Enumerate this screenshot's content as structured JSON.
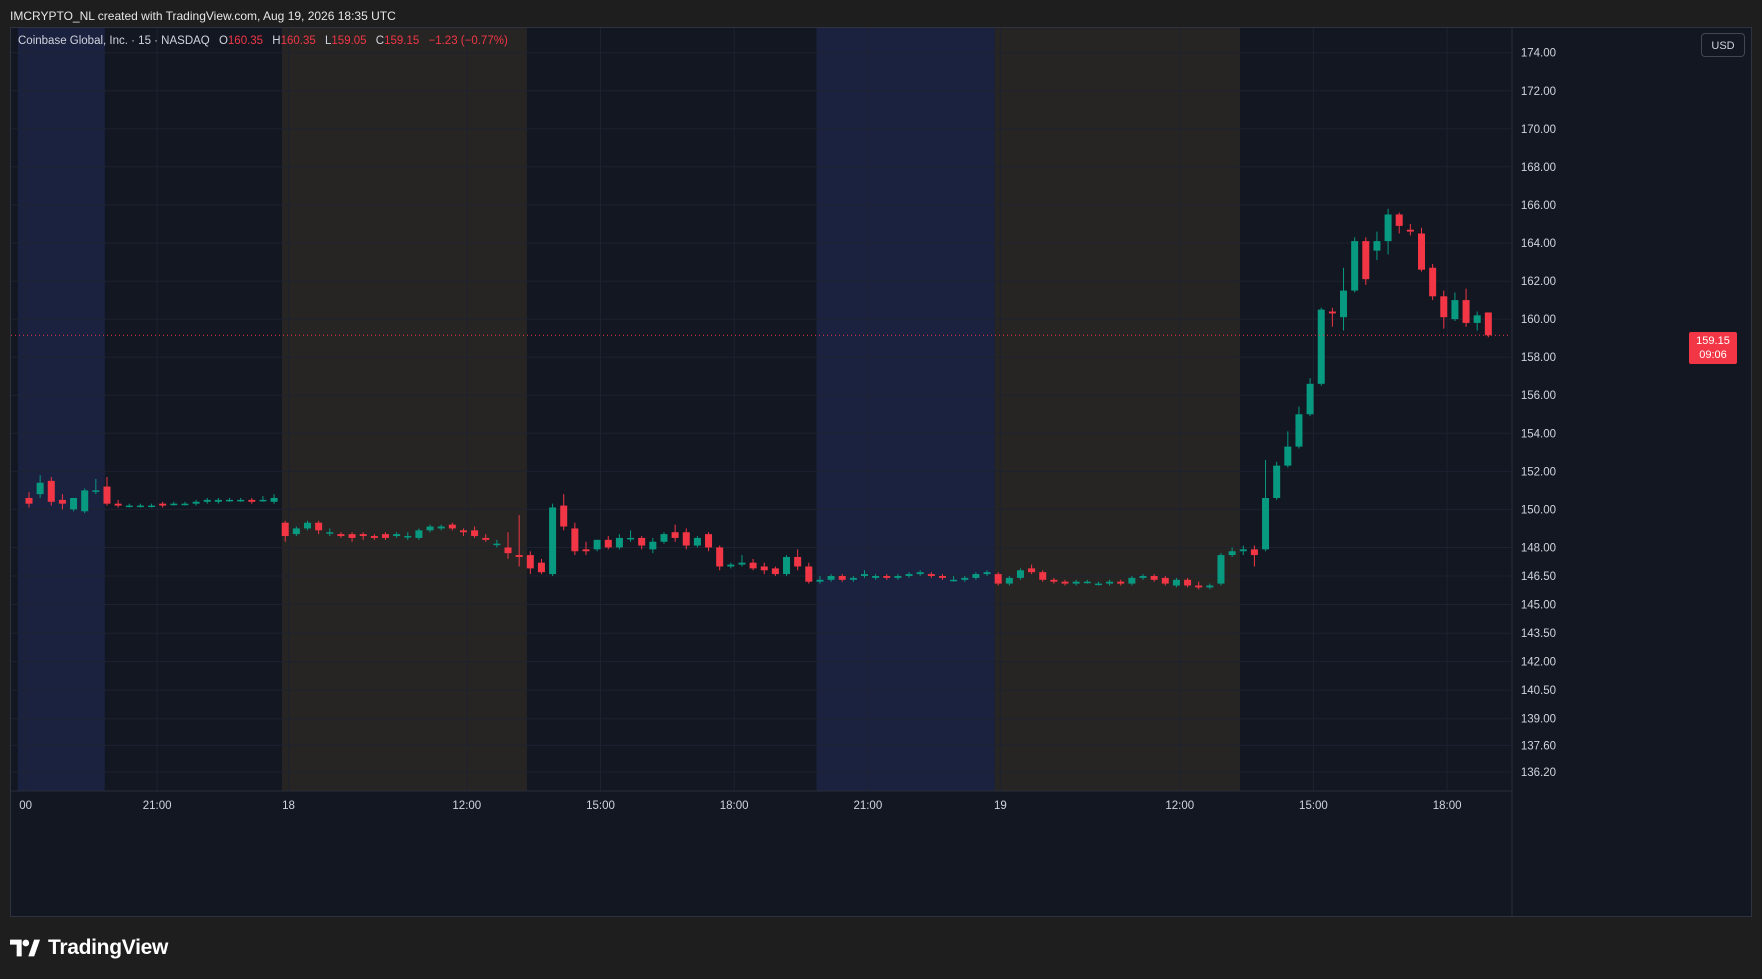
{
  "caption": "IMCRYPTO_NL created with TradingView.com, Aug 19, 2026 18:35 UTC",
  "legend": {
    "symbol": "Coinbase Global, Inc. · 15 · NASDAQ",
    "open_key": "O",
    "open_val": "160.35",
    "high_key": "H",
    "high_val": "160.35",
    "low_key": "L",
    "low_val": "159.05",
    "close_key": "C",
    "close_val": "159.15",
    "change": "−1.23 (−0.77%)"
  },
  "currency": "USD",
  "last_price": {
    "price": "159.15",
    "countdown": "09:06"
  },
  "brand": {
    "name": "TradingView"
  },
  "colors": {
    "up": "#089981",
    "down": "#f23645",
    "background": "#131722",
    "grid": "#1e2230",
    "session_blue": "#1a2240",
    "session_tan": "#262524"
  },
  "chart_data": {
    "type": "candlestick",
    "interval": "15",
    "ylim": [
      135.2,
      175.3
    ],
    "y_ticks": [
      174.0,
      172.0,
      170.0,
      168.0,
      166.0,
      164.0,
      162.0,
      160.0,
      158.0,
      156.0,
      154.0,
      152.0,
      150.0,
      148.0,
      146.5,
      145.0,
      143.5,
      142.0,
      140.5,
      139.0,
      137.6,
      136.2
    ],
    "x_ticks": [
      {
        "label": "00",
        "index": -0.3
      },
      {
        "label": "21:00",
        "index": 11.5
      },
      {
        "label": "18",
        "index": 23.3
      },
      {
        "label": "12:00",
        "index": 39.3
      },
      {
        "label": "15:00",
        "index": 51.3
      },
      {
        "label": "18:00",
        "index": 63.3
      },
      {
        "label": "21:00",
        "index": 75.3
      },
      {
        "label": "19",
        "index": 87.2
      },
      {
        "label": "12:00",
        "index": 103.3
      },
      {
        "label": "15:00",
        "index": 115.3
      },
      {
        "label": "18:00",
        "index": 127.3
      }
    ],
    "sessions": [
      {
        "start": -1.0,
        "end": 6.8,
        "type": "blue"
      },
      {
        "start": 22.7,
        "end": 44.7,
        "type": "tan"
      },
      {
        "start": 70.7,
        "end": 86.7,
        "type": "blue"
      },
      {
        "start": 86.7,
        "end": 108.7,
        "type": "tan"
      }
    ],
    "candles": [
      {
        "o": 150.6,
        "h": 150.9,
        "l": 150.1,
        "c": 150.3
      },
      {
        "o": 150.8,
        "h": 151.8,
        "l": 150.6,
        "c": 151.4
      },
      {
        "o": 151.5,
        "h": 151.7,
        "l": 150.2,
        "c": 150.4
      },
      {
        "o": 150.5,
        "h": 150.8,
        "l": 150.0,
        "c": 150.3
      },
      {
        "o": 150.0,
        "h": 150.6,
        "l": 149.9,
        "c": 150.6
      },
      {
        "o": 149.9,
        "h": 151.1,
        "l": 149.8,
        "c": 151.0
      },
      {
        "o": 151.0,
        "h": 151.6,
        "l": 150.8,
        "c": 151.0
      },
      {
        "o": 151.2,
        "h": 151.7,
        "l": 150.2,
        "c": 150.3
      },
      {
        "o": 150.3,
        "h": 150.5,
        "l": 150.1,
        "c": 150.2
      },
      {
        "o": 150.2,
        "h": 150.3,
        "l": 150.1,
        "c": 150.2
      },
      {
        "o": 150.2,
        "h": 150.3,
        "l": 150.1,
        "c": 150.2
      },
      {
        "o": 150.2,
        "h": 150.3,
        "l": 150.1,
        "c": 150.2
      },
      {
        "o": 150.3,
        "h": 150.4,
        "l": 150.1,
        "c": 150.2
      },
      {
        "o": 150.3,
        "h": 150.4,
        "l": 150.2,
        "c": 150.3
      },
      {
        "o": 150.3,
        "h": 150.4,
        "l": 150.2,
        "c": 150.3
      },
      {
        "o": 150.3,
        "h": 150.5,
        "l": 150.2,
        "c": 150.4
      },
      {
        "o": 150.4,
        "h": 150.6,
        "l": 150.3,
        "c": 150.5
      },
      {
        "o": 150.4,
        "h": 150.6,
        "l": 150.3,
        "c": 150.5
      },
      {
        "o": 150.5,
        "h": 150.6,
        "l": 150.4,
        "c": 150.5
      },
      {
        "o": 150.5,
        "h": 150.6,
        "l": 150.4,
        "c": 150.5
      },
      {
        "o": 150.5,
        "h": 150.6,
        "l": 150.3,
        "c": 150.4
      },
      {
        "o": 150.5,
        "h": 150.7,
        "l": 150.4,
        "c": 150.5
      },
      {
        "o": 150.4,
        "h": 150.8,
        "l": 150.3,
        "c": 150.6
      },
      {
        "o": 149.3,
        "h": 149.4,
        "l": 148.3,
        "c": 148.6
      },
      {
        "o": 148.7,
        "h": 149.1,
        "l": 148.6,
        "c": 149.0
      },
      {
        "o": 149.0,
        "h": 149.4,
        "l": 148.9,
        "c": 149.3
      },
      {
        "o": 149.3,
        "h": 149.4,
        "l": 148.7,
        "c": 148.9
      },
      {
        "o": 148.8,
        "h": 149.0,
        "l": 148.6,
        "c": 148.8
      },
      {
        "o": 148.7,
        "h": 148.8,
        "l": 148.5,
        "c": 148.6
      },
      {
        "o": 148.7,
        "h": 148.8,
        "l": 148.3,
        "c": 148.5
      },
      {
        "o": 148.7,
        "h": 148.8,
        "l": 148.4,
        "c": 148.6
      },
      {
        "o": 148.6,
        "h": 148.7,
        "l": 148.4,
        "c": 148.5
      },
      {
        "o": 148.7,
        "h": 148.8,
        "l": 148.4,
        "c": 148.5
      },
      {
        "o": 148.6,
        "h": 148.8,
        "l": 148.5,
        "c": 148.7
      },
      {
        "o": 148.6,
        "h": 148.8,
        "l": 148.4,
        "c": 148.6
      },
      {
        "o": 148.5,
        "h": 149.0,
        "l": 148.4,
        "c": 148.9
      },
      {
        "o": 148.9,
        "h": 149.2,
        "l": 148.8,
        "c": 149.1
      },
      {
        "o": 149.0,
        "h": 149.2,
        "l": 148.9,
        "c": 149.1
      },
      {
        "o": 149.2,
        "h": 149.3,
        "l": 148.9,
        "c": 149.0
      },
      {
        "o": 148.9,
        "h": 149.0,
        "l": 148.6,
        "c": 148.8
      },
      {
        "o": 148.9,
        "h": 149.1,
        "l": 148.5,
        "c": 148.6
      },
      {
        "o": 148.5,
        "h": 148.7,
        "l": 148.3,
        "c": 148.4
      },
      {
        "o": 148.2,
        "h": 148.4,
        "l": 148.0,
        "c": 148.2
      },
      {
        "o": 148.0,
        "h": 148.8,
        "l": 147.4,
        "c": 147.7
      },
      {
        "o": 147.6,
        "h": 149.7,
        "l": 147.0,
        "c": 147.5
      },
      {
        "o": 147.6,
        "h": 147.8,
        "l": 146.6,
        "c": 146.9
      },
      {
        "o": 147.2,
        "h": 147.4,
        "l": 146.6,
        "c": 146.7
      },
      {
        "o": 146.6,
        "h": 150.3,
        "l": 146.5,
        "c": 150.1
      },
      {
        "o": 150.2,
        "h": 150.8,
        "l": 148.9,
        "c": 149.1
      },
      {
        "o": 149.0,
        "h": 149.3,
        "l": 147.6,
        "c": 147.8
      },
      {
        "o": 147.9,
        "h": 148.3,
        "l": 147.6,
        "c": 147.8
      },
      {
        "o": 147.9,
        "h": 148.4,
        "l": 147.8,
        "c": 148.4
      },
      {
        "o": 148.4,
        "h": 148.6,
        "l": 147.9,
        "c": 148.0
      },
      {
        "o": 148.0,
        "h": 148.7,
        "l": 147.9,
        "c": 148.5
      },
      {
        "o": 148.5,
        "h": 148.9,
        "l": 148.3,
        "c": 148.5
      },
      {
        "o": 148.5,
        "h": 148.6,
        "l": 147.9,
        "c": 148.1
      },
      {
        "o": 147.9,
        "h": 148.5,
        "l": 147.7,
        "c": 148.3
      },
      {
        "o": 148.3,
        "h": 148.8,
        "l": 148.2,
        "c": 148.7
      },
      {
        "o": 148.8,
        "h": 149.2,
        "l": 148.3,
        "c": 148.5
      },
      {
        "o": 148.8,
        "h": 149.0,
        "l": 147.9,
        "c": 148.1
      },
      {
        "o": 148.1,
        "h": 148.6,
        "l": 148.0,
        "c": 148.5
      },
      {
        "o": 148.7,
        "h": 148.8,
        "l": 147.8,
        "c": 148.0
      },
      {
        "o": 148.0,
        "h": 148.1,
        "l": 146.8,
        "c": 147.0
      },
      {
        "o": 147.0,
        "h": 147.2,
        "l": 146.9,
        "c": 147.1
      },
      {
        "o": 147.1,
        "h": 147.6,
        "l": 147.0,
        "c": 147.2
      },
      {
        "o": 147.2,
        "h": 147.4,
        "l": 146.8,
        "c": 146.9
      },
      {
        "o": 147.0,
        "h": 147.2,
        "l": 146.6,
        "c": 146.8
      },
      {
        "o": 146.9,
        "h": 147.0,
        "l": 146.5,
        "c": 146.6
      },
      {
        "o": 146.6,
        "h": 147.6,
        "l": 146.5,
        "c": 147.5
      },
      {
        "o": 147.5,
        "h": 147.9,
        "l": 146.8,
        "c": 147.0
      },
      {
        "o": 147.0,
        "h": 147.2,
        "l": 146.1,
        "c": 146.2
      },
      {
        "o": 146.2,
        "h": 146.5,
        "l": 146.1,
        "c": 146.3
      },
      {
        "o": 146.3,
        "h": 146.6,
        "l": 146.2,
        "c": 146.5
      },
      {
        "o": 146.5,
        "h": 146.6,
        "l": 146.2,
        "c": 146.3
      },
      {
        "o": 146.3,
        "h": 146.5,
        "l": 146.2,
        "c": 146.4
      },
      {
        "o": 146.5,
        "h": 146.8,
        "l": 146.4,
        "c": 146.6
      },
      {
        "o": 146.4,
        "h": 146.6,
        "l": 146.3,
        "c": 146.5
      },
      {
        "o": 146.5,
        "h": 146.6,
        "l": 146.3,
        "c": 146.4
      },
      {
        "o": 146.4,
        "h": 146.6,
        "l": 146.3,
        "c": 146.5
      },
      {
        "o": 146.5,
        "h": 146.7,
        "l": 146.4,
        "c": 146.6
      },
      {
        "o": 146.6,
        "h": 146.8,
        "l": 146.5,
        "c": 146.7
      },
      {
        "o": 146.6,
        "h": 146.7,
        "l": 146.4,
        "c": 146.5
      },
      {
        "o": 146.5,
        "h": 146.6,
        "l": 146.3,
        "c": 146.4
      },
      {
        "o": 146.3,
        "h": 146.5,
        "l": 146.2,
        "c": 146.3
      },
      {
        "o": 146.3,
        "h": 146.5,
        "l": 146.2,
        "c": 146.4
      },
      {
        "o": 146.4,
        "h": 146.7,
        "l": 146.3,
        "c": 146.6
      },
      {
        "o": 146.6,
        "h": 146.8,
        "l": 146.5,
        "c": 146.7
      },
      {
        "o": 146.6,
        "h": 146.7,
        "l": 146.0,
        "c": 146.1
      },
      {
        "o": 146.1,
        "h": 146.5,
        "l": 146.0,
        "c": 146.4
      },
      {
        "o": 146.4,
        "h": 146.9,
        "l": 146.3,
        "c": 146.8
      },
      {
        "o": 146.9,
        "h": 147.1,
        "l": 146.6,
        "c": 146.7
      },
      {
        "o": 146.7,
        "h": 146.8,
        "l": 146.2,
        "c": 146.3
      },
      {
        "o": 146.3,
        "h": 146.4,
        "l": 146.1,
        "c": 146.2
      },
      {
        "o": 146.2,
        "h": 146.3,
        "l": 146.0,
        "c": 146.1
      },
      {
        "o": 146.1,
        "h": 146.3,
        "l": 146.0,
        "c": 146.2
      },
      {
        "o": 146.2,
        "h": 146.3,
        "l": 146.1,
        "c": 146.2
      },
      {
        "o": 146.1,
        "h": 146.2,
        "l": 146.0,
        "c": 146.1
      },
      {
        "o": 146.1,
        "h": 146.3,
        "l": 146.0,
        "c": 146.2
      },
      {
        "o": 146.2,
        "h": 146.3,
        "l": 146.0,
        "c": 146.1
      },
      {
        "o": 146.1,
        "h": 146.5,
        "l": 146.0,
        "c": 146.4
      },
      {
        "o": 146.4,
        "h": 146.6,
        "l": 146.3,
        "c": 146.5
      },
      {
        "o": 146.5,
        "h": 146.6,
        "l": 146.2,
        "c": 146.3
      },
      {
        "o": 146.4,
        "h": 146.5,
        "l": 146.0,
        "c": 146.1
      },
      {
        "o": 146.0,
        "h": 146.4,
        "l": 145.9,
        "c": 146.3
      },
      {
        "o": 146.3,
        "h": 146.4,
        "l": 145.9,
        "c": 146.0
      },
      {
        "o": 146.0,
        "h": 146.2,
        "l": 145.8,
        "c": 145.9
      },
      {
        "o": 145.9,
        "h": 146.1,
        "l": 145.8,
        "c": 146.0
      },
      {
        "o": 146.1,
        "h": 147.7,
        "l": 146.0,
        "c": 147.6
      },
      {
        "o": 147.6,
        "h": 148.0,
        "l": 147.5,
        "c": 147.8
      },
      {
        "o": 147.8,
        "h": 148.1,
        "l": 147.6,
        "c": 147.9
      },
      {
        "o": 147.9,
        "h": 148.1,
        "l": 147.0,
        "c": 147.6
      },
      {
        "o": 147.9,
        "h": 152.6,
        "l": 147.8,
        "c": 150.6
      },
      {
        "o": 150.6,
        "h": 152.5,
        "l": 150.5,
        "c": 152.3
      },
      {
        "o": 152.3,
        "h": 154.1,
        "l": 152.2,
        "c": 153.3
      },
      {
        "o": 153.3,
        "h": 155.4,
        "l": 153.2,
        "c": 155.0
      },
      {
        "o": 155.0,
        "h": 156.9,
        "l": 154.9,
        "c": 156.6
      },
      {
        "o": 156.6,
        "h": 160.6,
        "l": 156.5,
        "c": 160.5
      },
      {
        "o": 160.4,
        "h": 160.6,
        "l": 159.6,
        "c": 160.3
      },
      {
        "o": 160.1,
        "h": 162.7,
        "l": 159.4,
        "c": 161.5
      },
      {
        "o": 161.5,
        "h": 164.3,
        "l": 161.4,
        "c": 164.1
      },
      {
        "o": 164.1,
        "h": 164.3,
        "l": 161.8,
        "c": 162.1
      },
      {
        "o": 163.6,
        "h": 164.6,
        "l": 163.1,
        "c": 164.1
      },
      {
        "o": 164.1,
        "h": 165.8,
        "l": 163.4,
        "c": 165.5
      },
      {
        "o": 165.5,
        "h": 165.6,
        "l": 164.5,
        "c": 164.9
      },
      {
        "o": 164.7,
        "h": 165.0,
        "l": 164.4,
        "c": 164.6
      },
      {
        "o": 164.5,
        "h": 164.8,
        "l": 162.5,
        "c": 162.6
      },
      {
        "o": 162.7,
        "h": 162.9,
        "l": 161.0,
        "c": 161.2
      },
      {
        "o": 161.2,
        "h": 161.5,
        "l": 159.5,
        "c": 160.1
      },
      {
        "o": 160.0,
        "h": 161.4,
        "l": 159.9,
        "c": 161.0
      },
      {
        "o": 161.0,
        "h": 161.6,
        "l": 159.6,
        "c": 159.8
      },
      {
        "o": 159.8,
        "h": 160.4,
        "l": 159.4,
        "c": 160.2
      },
      {
        "o": 160.35,
        "h": 160.35,
        "l": 159.05,
        "c": 159.15
      }
    ]
  }
}
